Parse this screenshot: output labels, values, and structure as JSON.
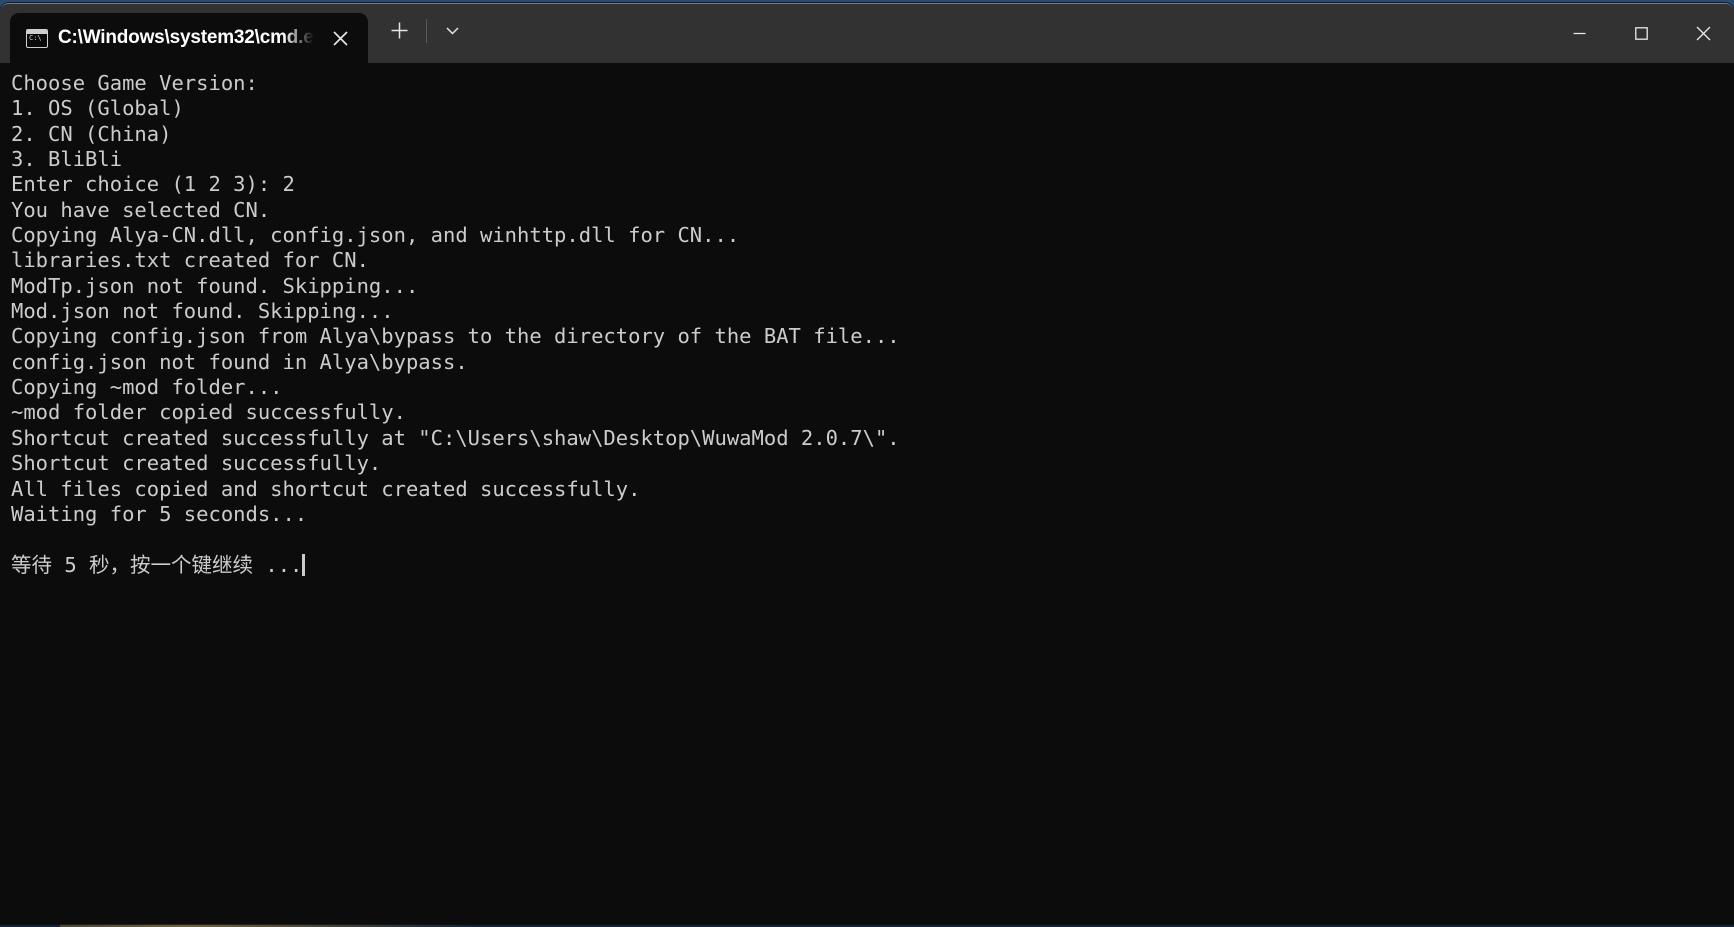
{
  "window": {
    "tab": {
      "title": "C:\\Windows\\system32\\cmd.e",
      "icon": "cmd-console-icon",
      "close_label": "×"
    },
    "new_tab_label": "+",
    "dropdown_label": "⌄",
    "controls": {
      "minimize_label": "—",
      "maximize_label": "□",
      "close_label": "✕"
    },
    "colors": {
      "titlebar_bg": "#323232",
      "terminal_bg": "#0c0c0c",
      "terminal_fg": "#cccccc",
      "tab_active_bg": "#0c0c0c"
    }
  },
  "console": {
    "lines": [
      "Choose Game Version:",
      "1. OS (Global)",
      "2. CN (China)",
      "3. BliBli",
      "Enter choice (1 2 3): 2",
      "You have selected CN.",
      "Copying Alya-CN.dll, config.json, and winhttp.dll for CN...",
      "libraries.txt created for CN.",
      "ModTp.json not found. Skipping...",
      "Mod.json not found. Skipping...",
      "Copying config.json from Alya\\bypass to the directory of the BAT file...",
      "config.json not found in Alya\\bypass.",
      "Copying ~mod folder...",
      "~mod folder copied successfully.",
      "Shortcut created successfully at \"C:\\Users\\shaw\\Desktop\\WuwaMod 2.0.7\\\".",
      "Shortcut created successfully.",
      "All files copied and shortcut created successfully.",
      "Waiting for 5 seconds...",
      "",
      "等待 5 秒，按一个键继续 ..."
    ],
    "prompt_choice_value": "2",
    "selected_version": "CN",
    "shortcut_path": "C:\\Users\\shaw\\Desktop\\WuwaMod 2.0.7\\",
    "wait_seconds": "5"
  }
}
